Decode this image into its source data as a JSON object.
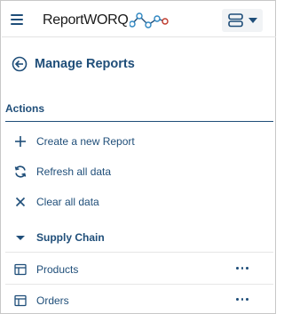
{
  "app": {
    "logo_text": "ReportWORQ",
    "menu_icon": "hamburger-icon",
    "server_icon": "server-icon"
  },
  "header": {
    "title": "Manage Reports",
    "back_icon": "circle-arrow-left-icon"
  },
  "actions": {
    "section_label": "Actions",
    "items": [
      {
        "label": "Create a new Report",
        "icon": "plus-icon"
      },
      {
        "label": "Refresh all data",
        "icon": "refresh-icon"
      },
      {
        "label": "Clear all data",
        "icon": "x-icon"
      }
    ]
  },
  "group": {
    "label": "Supply Chain",
    "icon": "caret-down-icon",
    "items": [
      {
        "label": "Products",
        "icon": "table-icon",
        "more_icon": "ellipsis-icon"
      },
      {
        "label": "Orders",
        "icon": "table-icon",
        "more_icon": "ellipsis-icon"
      }
    ]
  },
  "colors": {
    "primary": "#1f4e79",
    "logo_node_blue": "#2e86c1",
    "logo_node_red": "#c0392b"
  }
}
